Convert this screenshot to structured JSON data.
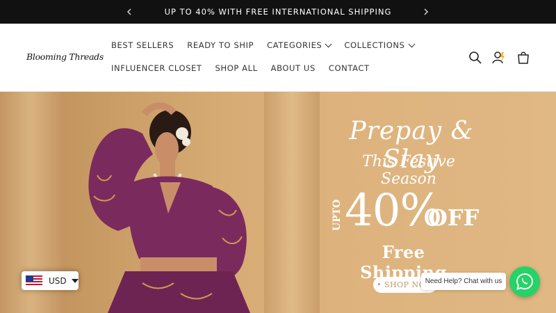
{
  "announcement": {
    "text": "UP TO 40% WITH FREE INTERNATIONAL SHIPPING",
    "prev_icon": "chevron-left-icon",
    "next_icon": "chevron-right-icon"
  },
  "header": {
    "logo": "Blooming Threads",
    "nav_row1": [
      {
        "label": "BEST SELLERS",
        "dropdown": false
      },
      {
        "label": "READY TO SHIP",
        "dropdown": false
      },
      {
        "label": "CATEGORIES",
        "dropdown": true
      },
      {
        "label": "COLLECTIONS",
        "dropdown": true
      }
    ],
    "nav_row2": [
      {
        "label": "INFLUENCER CLOSET",
        "dropdown": false
      },
      {
        "label": "SHOP ALL",
        "dropdown": false
      },
      {
        "label": "ABOUT US",
        "dropdown": false
      },
      {
        "label": "CONTACT",
        "dropdown": false
      }
    ],
    "icons": [
      "search-icon",
      "account-icon",
      "cart-icon"
    ]
  },
  "hero": {
    "headline": "Prepay & Slay",
    "subheadline": "This Festive Season",
    "upto": "UPTO",
    "percent": "40%",
    "off": "OFF",
    "shipping": "Free Shipping",
    "cta": "• SHOP NOW",
    "colors": {
      "background": "#d6ab74",
      "text": "#ffffff",
      "dress": "#7b2a5e"
    }
  },
  "currency": {
    "code": "USD",
    "flag": "us-flag-icon"
  },
  "chat": {
    "bubble": "Need Help? Chat with us",
    "icon": "whatsapp-icon",
    "color": "#25d366"
  }
}
